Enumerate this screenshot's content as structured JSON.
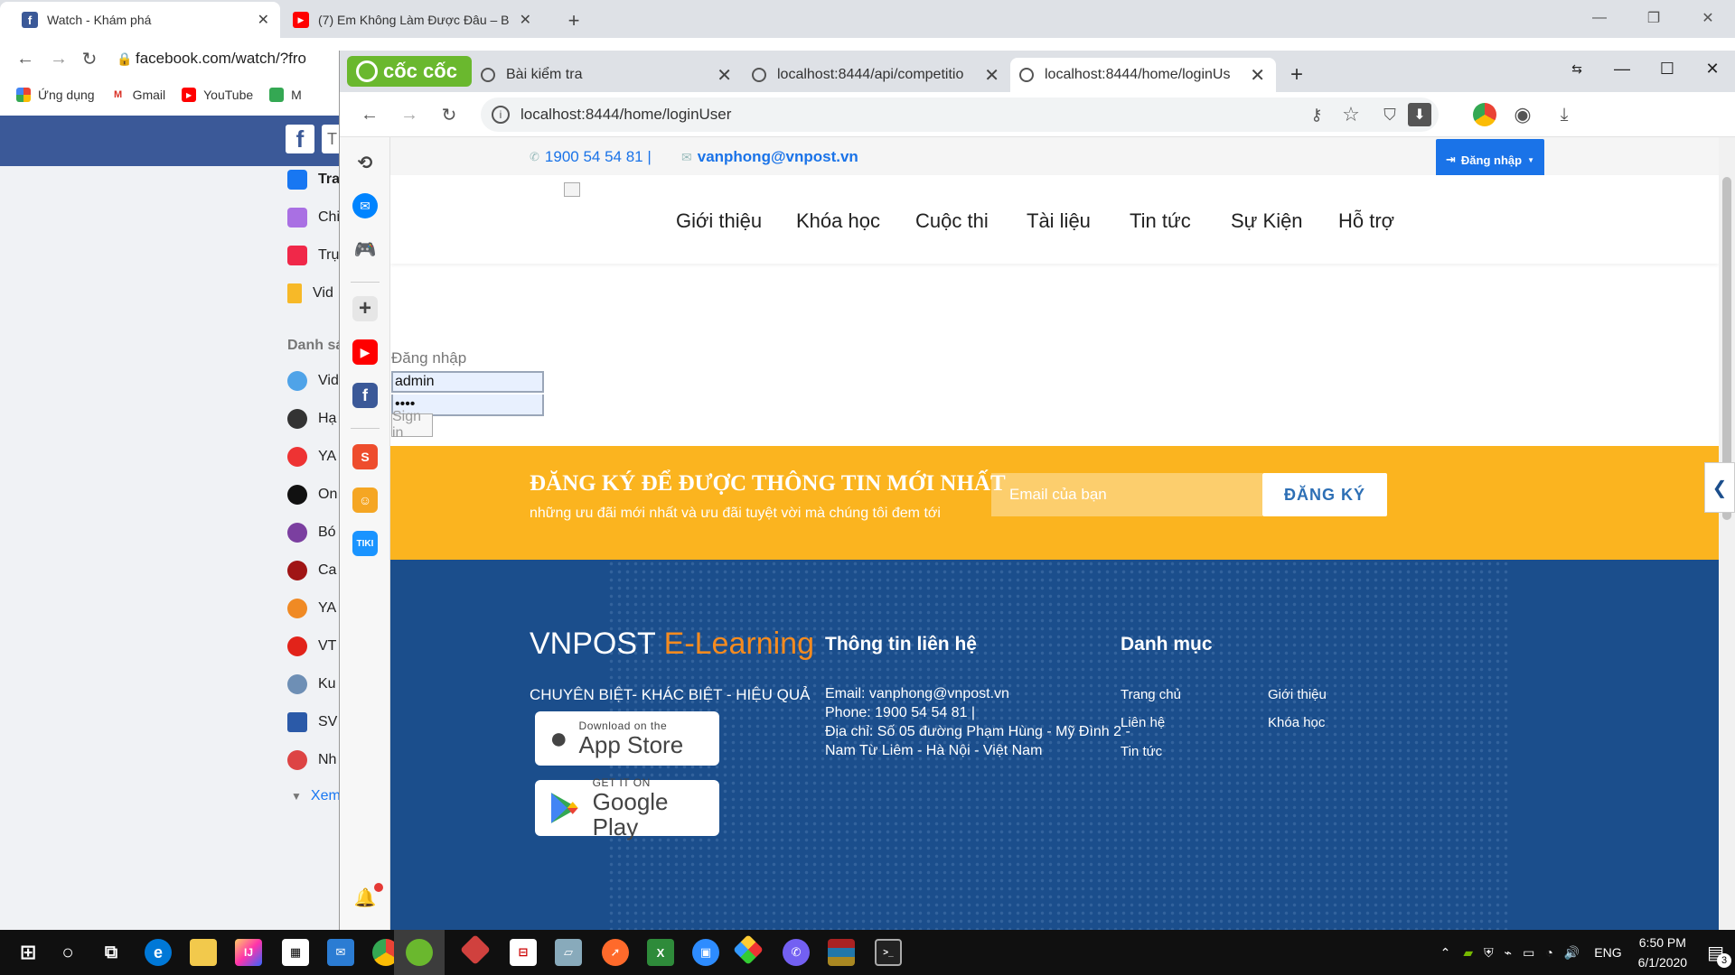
{
  "back_browser": {
    "tabs": [
      {
        "title": "Watch - Khám phá"
      },
      {
        "title": "(7) Em Không Làm Được Đâu – B"
      }
    ],
    "url": "facebook.com/watch/?fro",
    "bookmarks": [
      "Ứng dụng",
      "Gmail",
      "YouTube",
      "M"
    ]
  },
  "facebook": {
    "nav_items": [
      "Tra",
      "Chi",
      "Trụ",
      "Vid"
    ],
    "section_title": "Danh sá",
    "list_items": [
      "Vid",
      "Hạ",
      "YA",
      "On",
      "Bó",
      "Ca",
      "YA",
      "VT",
      "Ku",
      "SV",
      "Nh"
    ],
    "see_more": "Xem"
  },
  "front_browser": {
    "logo": "cốc cốc",
    "tabs": [
      {
        "title": "Bài kiểm tra"
      },
      {
        "title": "localhost:8444/api/competitio"
      },
      {
        "title": "localhost:8444/home/loginUs"
      }
    ],
    "url": "localhost:8444/home/loginUser"
  },
  "site": {
    "topbar": {
      "phone": "1900 54 54 81 |",
      "email": "vanphong@vnpost.vn",
      "login_button": "Đăng nhập"
    },
    "nav": [
      "Giới thiệu",
      "Khóa học",
      "Cuộc thi",
      "Tài liệu",
      "Tin tức",
      "Sự Kiện",
      "Hỗ trợ"
    ],
    "login_form": {
      "title": "Đăng nhập",
      "username": "admin",
      "password": "••••",
      "submit": "Sign in"
    },
    "newsletter": {
      "title": "ĐĂNG KÝ ĐỂ ĐƯỢC THÔNG TIN MỚI NHẤT",
      "subtitle": "những ưu đãi mới nhất và ưu đãi tuyệt vời mà chúng tôi đem tới",
      "placeholder": "Email của bạn",
      "button": "ĐĂNG KÝ"
    },
    "footer": {
      "brand_main": "VNPOST",
      "brand_accent": "E-Learning",
      "slogan": "CHUYÊN BIỆT- KHÁC BIỆT - HIỆU QUẢ",
      "appstore_small": "Download on the",
      "appstore_big": "App Store",
      "googleplay_small": "GET IT ON",
      "googleplay_big": "Google Play",
      "contact_title": "Thông tin liên hệ",
      "contact_email": "Email: vanphong@vnpost.vn",
      "contact_phone": "Phone: 1900 54 54 81 |",
      "contact_address_1": "Địa chỉ: Số 05 đường Phạm Hùng - Mỹ Đình 2 -",
      "contact_address_2": "Nam Từ Liêm - Hà Nội - Việt Nam",
      "menu_title": "Danh mục",
      "menu_col1": [
        "Trang chủ",
        "Liên hệ",
        "Tin tức"
      ],
      "menu_col2": [
        "Giới thiệu",
        "Khóa học"
      ]
    }
  },
  "taskbar": {
    "language": "ENG",
    "time": "6:50 PM",
    "date": "6/1/2020",
    "notifications": "3"
  },
  "colors": {
    "brand_blue": "#1b4e8c",
    "accent_orange": "#f68b1f",
    "newsletter_yellow": "#fbb41f",
    "link_blue": "#1a73e8"
  }
}
